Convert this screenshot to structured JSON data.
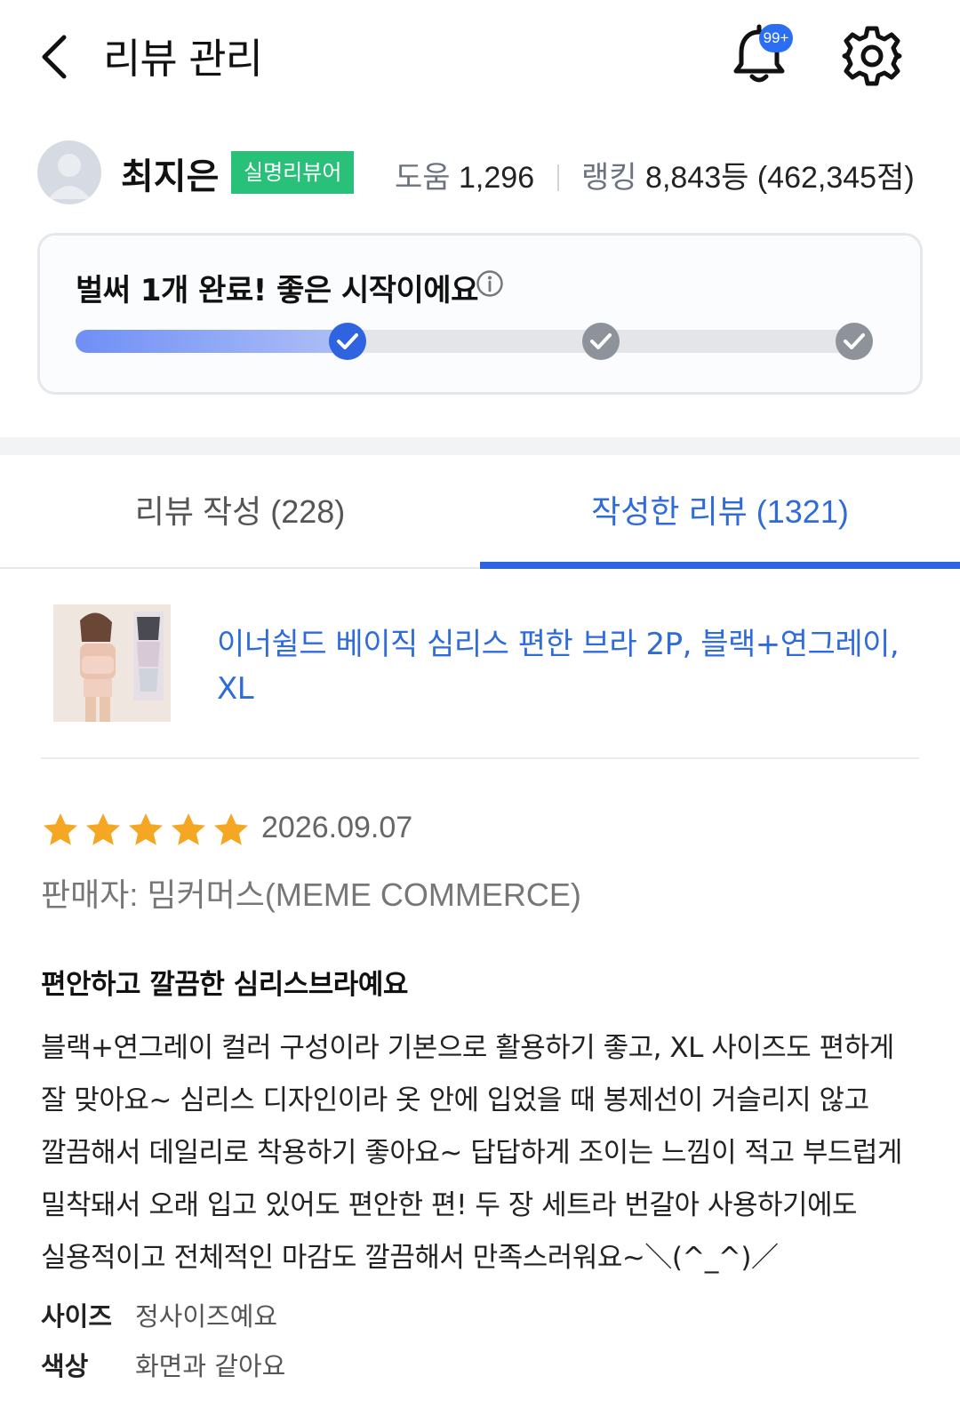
{
  "header": {
    "title": "리뷰 관리",
    "notification_badge": "99+"
  },
  "profile": {
    "name": "최지은",
    "badge": "실명리뷰어",
    "help_label": "도움",
    "help_count": "1,296",
    "ranking_label": "랭킹",
    "ranking_value": "8,843등 (462,345점)"
  },
  "progress": {
    "message": "벌써 1개 완료! 좋은 시작이에요",
    "fill_fraction": 0.34,
    "milestones": [
      {
        "state": "done",
        "color": "#2f64e0"
      },
      {
        "state": "locked",
        "color": "#8e939b"
      },
      {
        "state": "locked",
        "color": "#8e939b"
      }
    ]
  },
  "tabs": [
    {
      "label": "리뷰 작성 (228)",
      "active": false
    },
    {
      "label": "작성한 리뷰 (1321)",
      "active": true
    }
  ],
  "product": {
    "title": "이너쉴드 베이직 심리스 편한 브라 2P, 블랙+연그레이, XL"
  },
  "review": {
    "rating": 5,
    "date": "2026.09.07",
    "seller": "판매자: 밈커머스(MEME COMMERCE)",
    "headline": "편안하고 깔끔한 심리스브라예요",
    "body_lines": [
      "블랙+연그레이 컬러 구성이라 기본으로 활용하기 좋고, XL 사이즈도 편하게",
      "잘 맞아요~ 심리스 디자인이라 옷 안에 입었을 때 봉제선이 거슬리지 않고",
      "깔끔해서 데일리로 착용하기 좋아요~ 답답하게 조이는 느낌이 적고 부드럽게",
      "밀착돼서 오래 입고 있어도 편안한 편! 두 장 세트라 번갈아 사용하기에도",
      "실용적이고 전체적인 마감도 깔끔해서 만족스러워요~＼(^_^)／"
    ],
    "attributes": [
      {
        "key": "사이즈",
        "value": "정사이즈예요"
      },
      {
        "key": "색상",
        "value": "화면과 같아요"
      }
    ]
  },
  "colors": {
    "accent": "#2f64e0",
    "badge_green": "#29c07a",
    "star": "#f5a623"
  }
}
